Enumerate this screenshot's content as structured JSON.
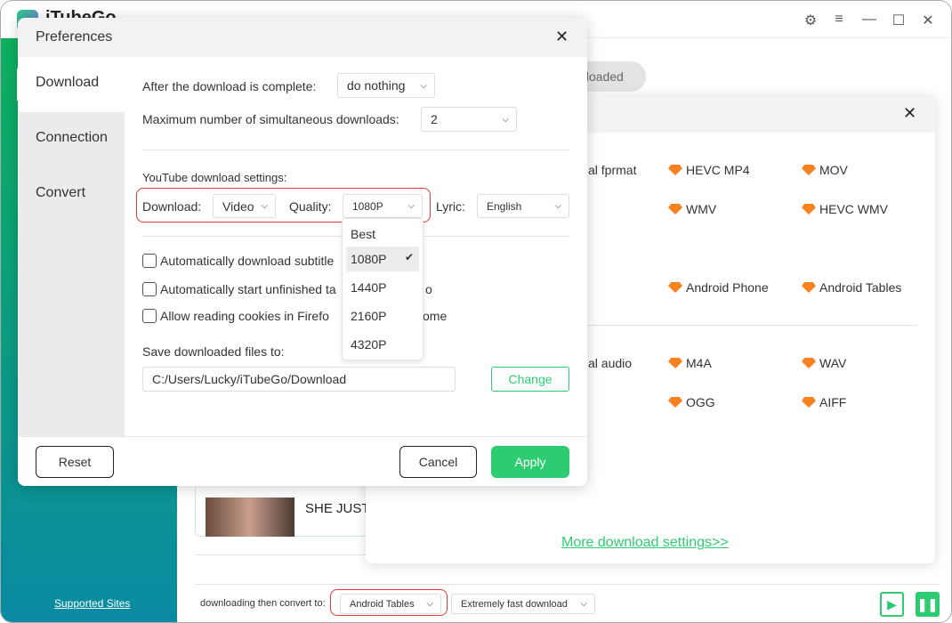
{
  "app": {
    "title": "iTubeGo",
    "supported_sites": "Supported Sites",
    "tab_downloaded": "nloaded",
    "video_title": "SHE JUST",
    "convert_label": "downloading then convert to:",
    "convert_value": "Android Tables",
    "speed_value": "Extremely fast download"
  },
  "format_panel": {
    "video_row_label": "al fprmat",
    "video_formats": [
      "HEVC MP4",
      "MOV",
      "WMV",
      "HEVC WMV"
    ],
    "device_formats": [
      "Android Phone",
      "Android Tables"
    ],
    "audio_row_label": "al audio",
    "audio_formats": [
      "M4A",
      "WAV",
      "OGG",
      "AIFF"
    ],
    "more_link": "More download settings>>"
  },
  "preferences": {
    "title": "Preferences",
    "nav": [
      "Download",
      "Connection",
      "Convert"
    ],
    "after_complete_label": "After the download is complete:",
    "after_complete_value": "do nothing",
    "max_downloads_label": "Maximum number of simultaneous downloads:",
    "max_downloads_value": "2",
    "youtube_label": "YouTube download settings:",
    "download_label": "Download:",
    "download_value": "Video",
    "quality_label": "Quality:",
    "quality_value": "1080P",
    "lyric_label": "Lyric:",
    "lyric_value": "English",
    "quality_options": [
      "Best",
      "1080P",
      "1440P",
      "2160P",
      "4320P"
    ],
    "checkboxes": [
      "Automatically download subtitle",
      "Automatically start unfinished ta",
      "Allow reading cookies in Firefo"
    ],
    "checkbox_tails": [
      "",
      "o",
      "ome"
    ],
    "save_label": "Save downloaded files to:",
    "save_path": "C:/Users/Lucky/iTubeGo/Download",
    "change": "Change",
    "reset": "Reset",
    "cancel": "Cancel",
    "apply": "Apply"
  },
  "colors": {
    "accent": "#2ecc71",
    "premium": "#f7821f",
    "highlight": "#e53935"
  }
}
